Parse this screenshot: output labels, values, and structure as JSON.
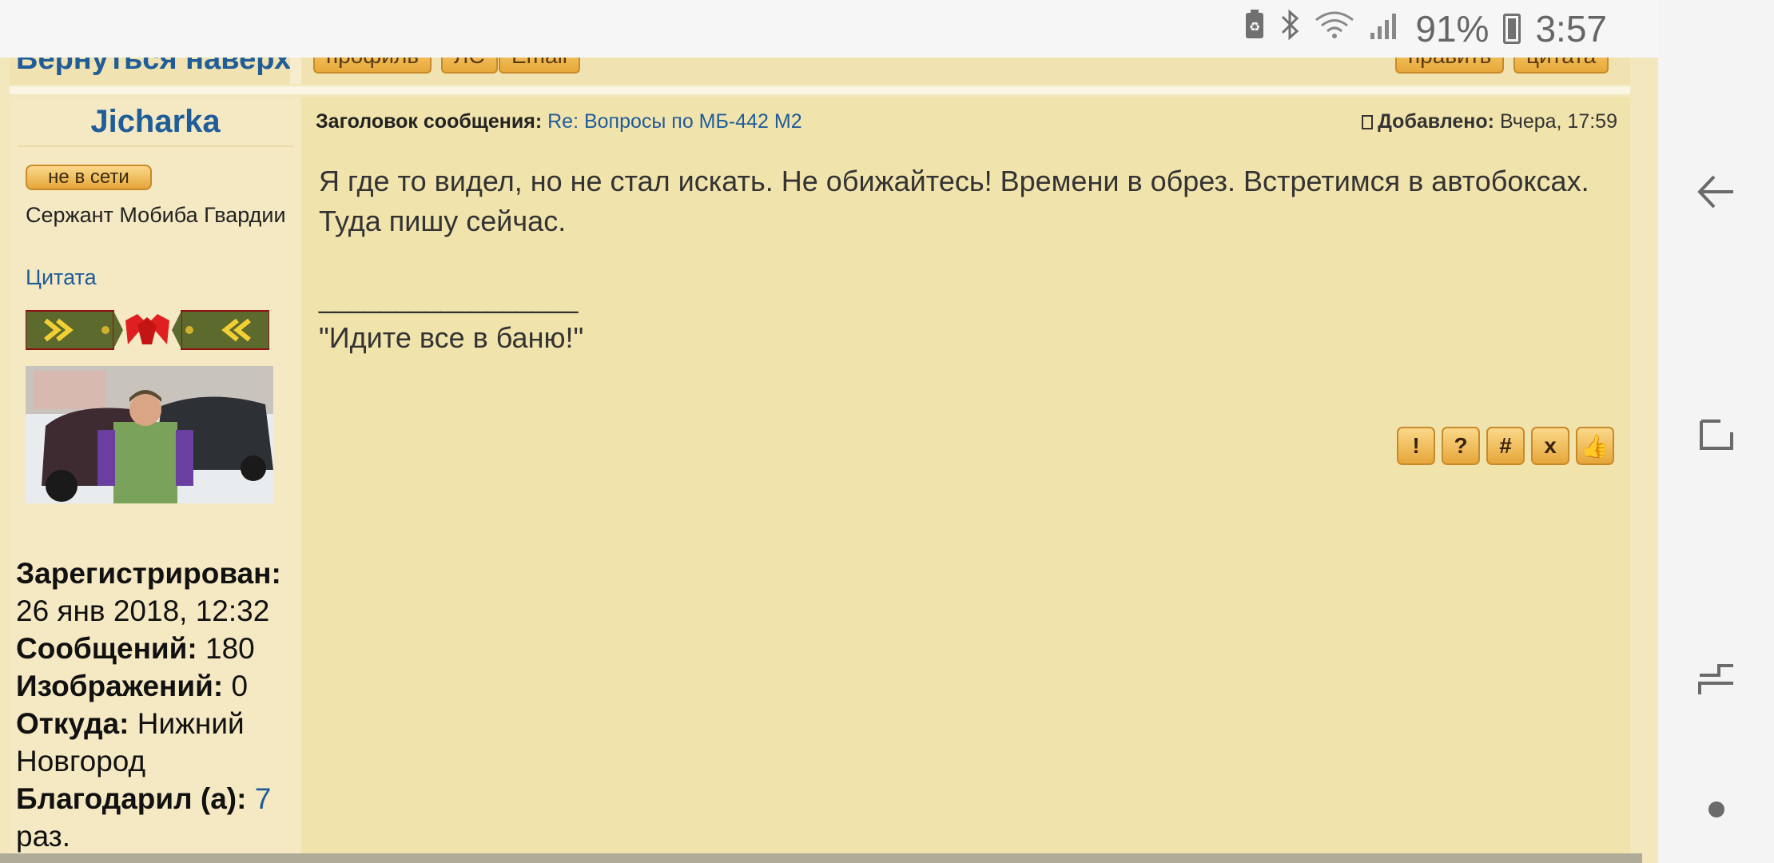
{
  "status_bar": {
    "battery_pct": "91%",
    "time": "3:57",
    "icons": [
      "battery-saver-icon",
      "bluetooth-icon",
      "wifi-icon",
      "signal-icon",
      "battery-icon"
    ]
  },
  "prev_post": {
    "back_to_top": "Вернуться наверх",
    "buttons": [
      "профиль",
      "ЛС",
      "Email"
    ],
    "right_buttons": [
      "править",
      "цитата"
    ]
  },
  "user": {
    "name": "Jicharka",
    "status": "не в сети",
    "rank": "Сержант Мобиба Гвардии",
    "quote": "Цитата",
    "registered_label": "Зарегистрирован:",
    "registered_value": "26 янв 2018, 12:32",
    "posts_label": "Сообщений:",
    "posts_value": "180",
    "images_label": "Изображений:",
    "images_value": "0",
    "from_label": "Откуда:",
    "from_value": "Нижний Новгород",
    "thanked_label": "Благодарил (а):",
    "thanked_value": "7",
    "thanked_suffix": "раз."
  },
  "post": {
    "subject_label": "Заголовок сообщения:",
    "subject_value": "Re: Вопросы по МБ-442 М2",
    "added_label": "Добавлено:",
    "added_value": "Вчера, 17:59",
    "text": "Я где то видел, но не стал искать. Не обижайтесь! Времени в обрез. Встретимся в автобоксах. Туда пишу сейчас.",
    "signature_separator": "_________________",
    "signature": "\"Идите все в баню!\"",
    "action_buttons": [
      "!",
      "?",
      "#",
      "x",
      "👍"
    ]
  },
  "colors": {
    "link": "#1f5c9a",
    "post_bg": "#f1e3ac",
    "user_bg": "#f5e9c3"
  }
}
